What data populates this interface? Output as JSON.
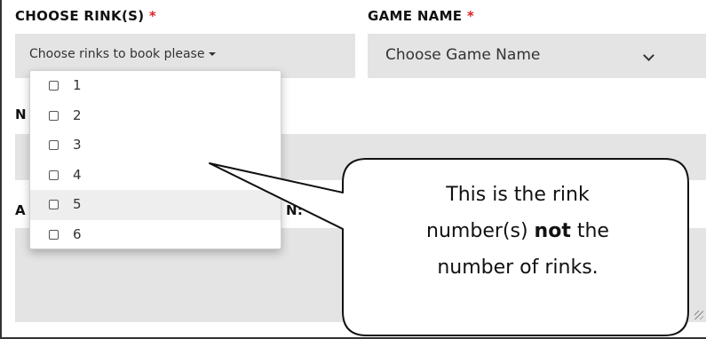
{
  "form": {
    "rink_label": "CHOOSE RINK(S)",
    "required_mark": "*",
    "game_label": "GAME NAME",
    "rink_placeholder": "Choose rinks to book please",
    "game_placeholder": "Choose Game Name",
    "partial_label_1": "N",
    "partial_label_2": "A",
    "partial_label_3": "N:"
  },
  "rink_options": [
    {
      "label": "1",
      "checked": false
    },
    {
      "label": "2",
      "checked": false
    },
    {
      "label": "3",
      "checked": false
    },
    {
      "label": "4",
      "checked": false
    },
    {
      "label": "5",
      "checked": false,
      "highlighted": true
    },
    {
      "label": "6",
      "checked": false
    }
  ],
  "callout": {
    "line1": "This is the rink",
    "line2_prefix": "number(s)",
    "line2_bold": "not",
    "line2_suffix": "the",
    "line3": "number of rinks."
  },
  "colors": {
    "required": "#e02020",
    "field_bg": "#e4e4e4"
  }
}
